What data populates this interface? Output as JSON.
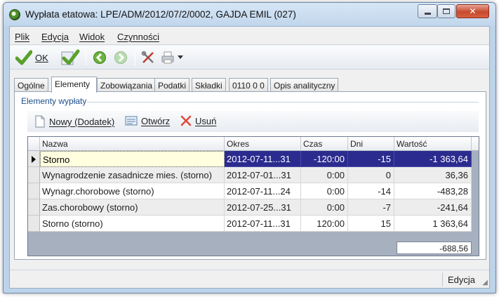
{
  "window": {
    "title": "Wypłata etatowa: LPE/ADM/2012/07/2/0002, GAJDA EMIL (027)"
  },
  "menu": {
    "items": [
      "Plik",
      "Edycja",
      "Widok",
      "Czynności"
    ]
  },
  "toolbar": {
    "ok_label": "OK"
  },
  "tabs": [
    "Ogólne",
    "Elementy",
    "Zobowiązania",
    "Podatki",
    "Składki",
    "0110 0 0",
    "Opis analityczny"
  ],
  "active_tab": "Elementy",
  "group": {
    "title": "Elementy wypłaty",
    "buttons": {
      "new": "Nowy (Dodatek)",
      "open": "Otwórz",
      "delete": "Usuń"
    }
  },
  "grid": {
    "columns": [
      "Nazwa",
      "Okres",
      "Czas",
      "Dni",
      "Wartość"
    ],
    "rows": [
      {
        "nazwa": "Storno",
        "okres": "2012-07-11...31",
        "czas": "-120:00",
        "dni": "-15",
        "wartosc": "-1 363,64"
      },
      {
        "nazwa": "Wynagrodzenie zasadnicze mies. (storno)",
        "okres": "2012-07-01...31",
        "czas": "0:00",
        "dni": "0",
        "wartosc": "36,36"
      },
      {
        "nazwa": "Wynagr.chorobowe (storno)",
        "okres": "2012-07-11...24",
        "czas": "0:00",
        "dni": "-14",
        "wartosc": "-483,28"
      },
      {
        "nazwa": "Zas.chorobowy (storno)",
        "okres": "2012-07-25...31",
        "czas": "0:00",
        "dni": "-7",
        "wartosc": "-241,64"
      },
      {
        "nazwa": "Storno (storno)",
        "okres": "2012-07-11...31",
        "czas": "120:00",
        "dni": "15",
        "wartosc": "1 363,64"
      }
    ],
    "total": "-688,56"
  },
  "status": {
    "mode": "Edycja"
  },
  "colors": {
    "selection": "#2b2b8f",
    "title_bar": "#c1d6ec",
    "close_button": "#c74a2f",
    "ok_check": "#5aa02c"
  },
  "icons": [
    "app-icon",
    "minimize-icon",
    "maximize-icon",
    "close-icon",
    "ok-check-icon",
    "check-icon",
    "back-arrow-icon",
    "forward-arrow-icon",
    "tools-icon",
    "print-icon",
    "dropdown-arrow-icon",
    "new-document-icon",
    "open-icon",
    "delete-icon",
    "row-pointer-icon",
    "size-grip-icon"
  ]
}
